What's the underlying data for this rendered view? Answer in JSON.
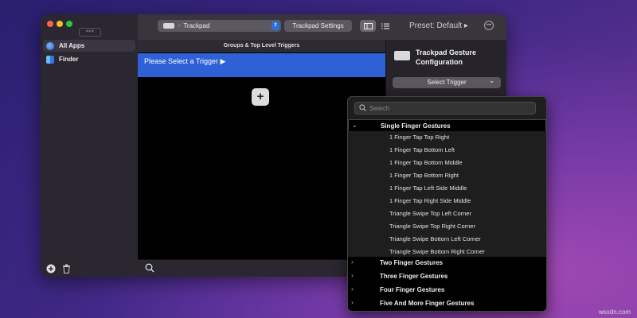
{
  "sidebar": {
    "collapse_label": "<<<",
    "items": [
      {
        "label": "All Apps",
        "icon": "globe-icon",
        "selected": true
      },
      {
        "label": "Finder",
        "icon": "finder-icon",
        "selected": false
      }
    ],
    "add_icon": "plus-circle-icon",
    "trash_icon": "trash-icon"
  },
  "toolbar": {
    "device_select": "Trackpad",
    "settings_label": "Trackpad Settings",
    "preset_label": "Preset: Default ▸",
    "more_icon": "ellipsis-circle-icon"
  },
  "trigger_list": {
    "header": "Groups & Top Level Triggers",
    "selected_row": "Please Select a Trigger ▶",
    "add_icon": "plus-icon"
  },
  "config": {
    "title": "Trackpad Gesture Configuration",
    "select_label": "Select Trigger",
    "select_arrow": "⌄"
  },
  "popup": {
    "search_placeholder": "Search",
    "open_group": {
      "label": "Single Finger Gestures",
      "chevron": "⌄",
      "items": [
        "1 Finger Tap Top Right",
        "1 Finger Tap Bottom Left",
        "1 Finger Tap Bottom Middle",
        "1 Finger Tap Bottom Right",
        "1 Finger Tap Left Side Middle",
        "1 Finger Tap Right Side Middle",
        "Triangle Swipe Top Left Corner",
        "Triangle Swipe Top Right Corner",
        "Triangle Swipe Bottom Left Corner",
        "Triangle Swipe Bottom Right Corner"
      ]
    },
    "closed_groups": [
      {
        "label": "Two Finger Gestures",
        "chevron": "›"
      },
      {
        "label": "Three Finger Gestures",
        "chevron": "›"
      },
      {
        "label": "Four Finger Gestures",
        "chevron": "›"
      },
      {
        "label": "Five And More Finger Gestures",
        "chevron": "›"
      }
    ]
  },
  "watermark": "wsxdn.com",
  "colors": {
    "accent": "#2f61d6",
    "window_bg": "#1f1f1f",
    "sidebar_bg": "#2b2730"
  }
}
